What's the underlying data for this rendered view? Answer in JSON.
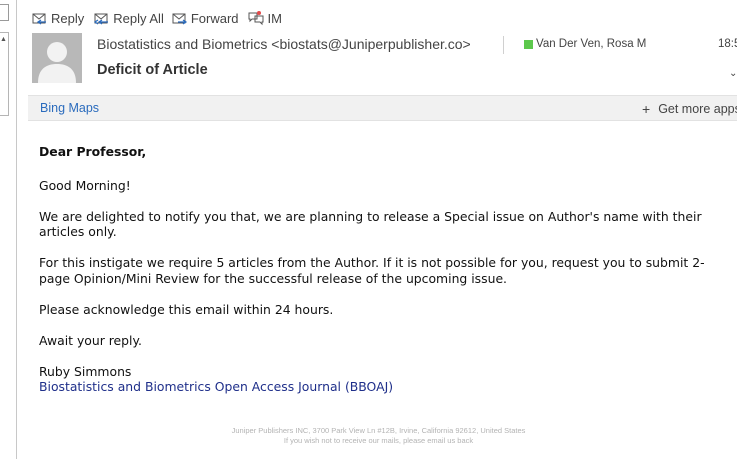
{
  "toolbar": {
    "reply": "Reply",
    "reply_all": "Reply All",
    "forward": "Forward",
    "im": "IM"
  },
  "header": {
    "from": "Biostatistics and Biometrics <biostats@Juniperpublisher.co>",
    "subject": "Deficit of Article",
    "recipient": "Van Der Ven, Rosa M",
    "time": "18:5",
    "presence_color": "#5cc84c"
  },
  "apps_bar": {
    "bing_maps": "Bing Maps",
    "get_more_apps": "Get more apps"
  },
  "message": {
    "greeting": "Dear Professor,",
    "paragraphs": [
      "Good Morning!",
      "We are delighted to notify you that, we are planning to release a Special issue on Author's name with their articles only.",
      "For this instigate we require 5 articles from the Author. If it is not possible for you, request you to submit 2-page Opinion/Mini Review for the successful release of the upcoming issue.",
      "Please acknowledge this email within 24 hours.",
      "Await your reply."
    ],
    "signature_name": "Ruby Simmons",
    "signature_journal": "Biostatistics and Biometrics Open Access Journal (BBOAJ)",
    "footer_address": "Juniper Publishers INC, 3700 Park View Ln #12B, Irvine, California 92612, United States",
    "footer_unsubscribe": "If you wish not to receive our mails, please email us back"
  },
  "icons": {
    "reply": "reply-icon",
    "reply_all": "reply-all-icon",
    "forward": "forward-icon",
    "im": "im-icon",
    "avatar": "person-silhouette"
  }
}
